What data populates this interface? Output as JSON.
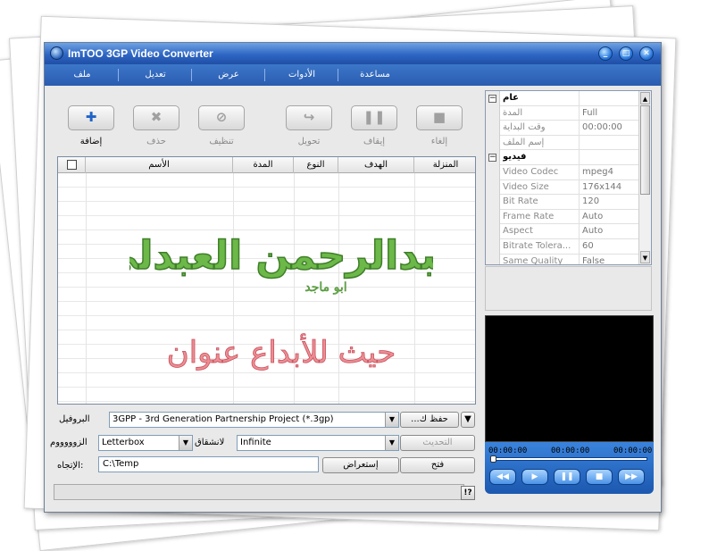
{
  "window": {
    "title": "ImTOO 3GP Video Converter"
  },
  "menu": [
    "ملف",
    "تعديل",
    "عرض",
    "الأدوات",
    "مساعدة"
  ],
  "toolbar": [
    {
      "label": "إضافة",
      "icon": "plus-icon",
      "enabled": true
    },
    {
      "label": "حذف",
      "icon": "x-icon",
      "enabled": false
    },
    {
      "label": "تنظيف",
      "icon": "clear-icon",
      "enabled": false
    },
    {
      "label": "تحويل",
      "icon": "convert-arrow-icon",
      "enabled": false
    },
    {
      "label": "إيقاف",
      "icon": "pause-icon",
      "enabled": false
    },
    {
      "label": "إلغاء",
      "icon": "stop-icon",
      "enabled": false
    }
  ],
  "file_list": {
    "columns": [
      "الأسم",
      "المدة",
      "النوع",
      "الهدف",
      "المنزلة"
    ],
    "watermark": {
      "logo_name": "عبدالرحمن العبدلي",
      "logo_subtext": "ابو ماجد",
      "tagline": "حيث للأبداع عنوان"
    }
  },
  "form": {
    "profile_label": "البروفيل",
    "profile_value": "3GPP - 3rd Generation Partnership Project  (*.3gp)",
    "save_as_label": "...حفظ ك",
    "zoom_label": "الزوووووم",
    "zoom_value": "Letterbox",
    "split_label": "لانشقاق",
    "split_value": "Infinite",
    "update_label": "التحديث",
    "direction_label": "الإتجاه:",
    "output_path": "C:\\Temp",
    "browse_label": "إستعراض",
    "open_label": "فتح"
  },
  "properties": {
    "general_category": "عام",
    "general": [
      {
        "key": "المدة",
        "value": "Full"
      },
      {
        "key": "وقت البداية",
        "value": "00:00:00"
      },
      {
        "key": "إسم الملف",
        "value": ""
      }
    ],
    "video_category": "فيديو",
    "video": [
      {
        "key": "Video Codec",
        "value": "mpeg4"
      },
      {
        "key": "Video Size",
        "value": "176x144"
      },
      {
        "key": "Bit Rate",
        "value": "120"
      },
      {
        "key": "Frame Rate",
        "value": "Auto"
      },
      {
        "key": "Aspect",
        "value": "Auto"
      },
      {
        "key": "Bitrate Tolera...",
        "value": "60"
      },
      {
        "key": "Same Quality",
        "value": "False"
      }
    ]
  },
  "player": {
    "time_start": "00:00:00",
    "time_current": "00:00:00",
    "time_end": "00:00:00",
    "seek_progress": 0
  },
  "status": {
    "help_label": "!?"
  },
  "colors": {
    "title_blue": "#2e66c4",
    "logo_green": "#5aa73a",
    "tagline_red": "#e0707a"
  }
}
